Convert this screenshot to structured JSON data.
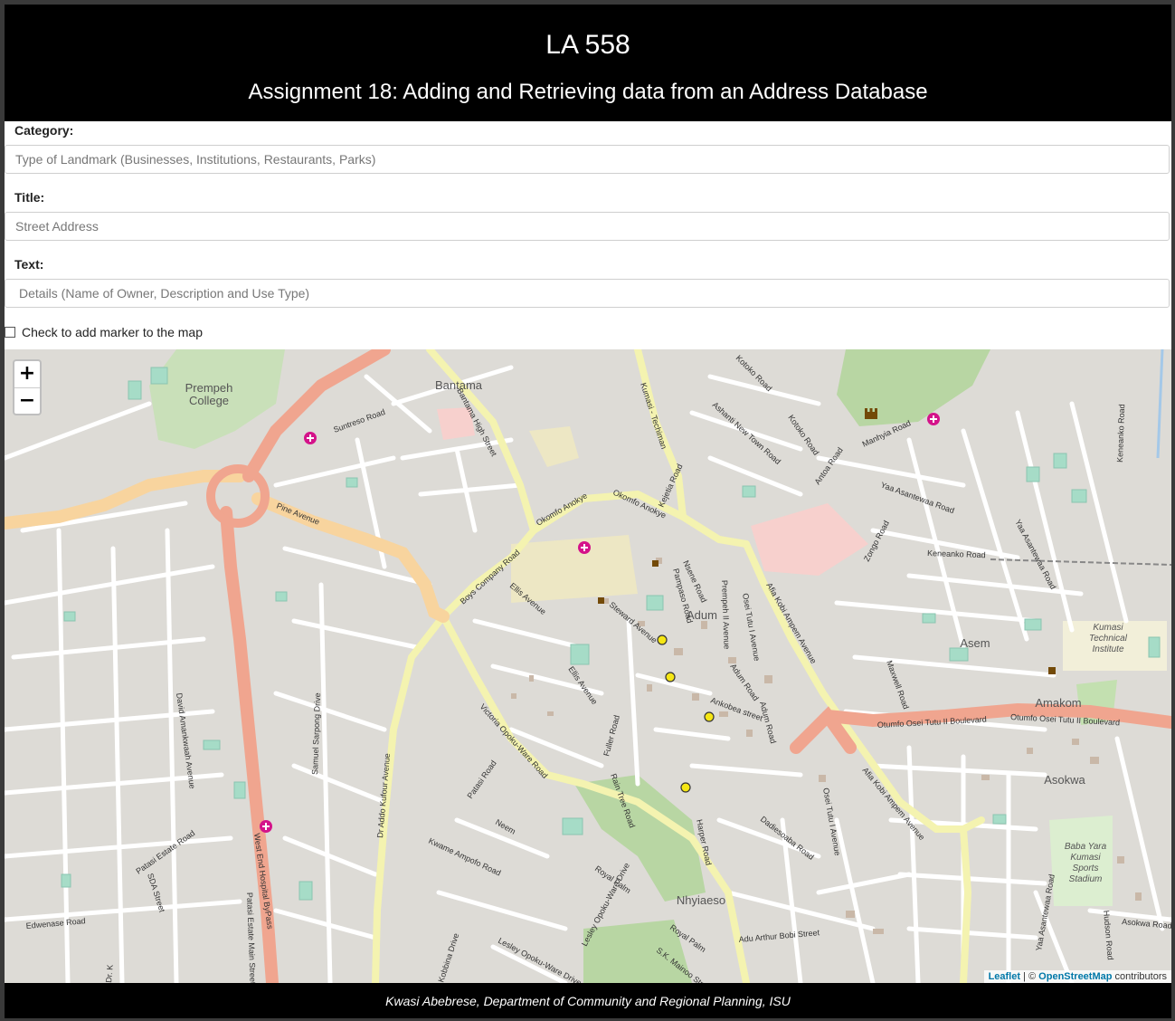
{
  "header": {
    "title": "LA 558",
    "subtitle": "Assignment 18: Adding and Retrieving data from an Address Database"
  },
  "form": {
    "category_label": "Category:",
    "category_placeholder": "Type of Landmark (Businesses, Institutions, Restaurants, Parks)",
    "title_label": "Title:",
    "title_placeholder": "Street Address",
    "text_label": "Text:",
    "text_placeholder": "Details (Name of Owner, Description and Use Type)",
    "checkbox_label": "Check to add marker to the map",
    "checkbox_checked": false
  },
  "map": {
    "zoom_in": "+",
    "zoom_out": "−",
    "attribution": {
      "leaflet": "Leaflet",
      "separator": " | © ",
      "osm": "OpenStreetMap",
      "suffix": " contributors"
    },
    "place_labels": {
      "prempeh": "Prempeh",
      "college": "College",
      "bantama": "Bantama",
      "adum": "Adum",
      "asem": "Asem",
      "amakom": "Amakom",
      "asokwa": "Asokwa",
      "nhyiaeso": "Nhyiaeso",
      "kumasi_tech_1": "Kumasi",
      "kumasi_tech_2": "Technical",
      "kumasi_tech_3": "Institute",
      "stadium_1": "Baba Yara",
      "stadium_2": "Kumasi",
      "stadium_3": "Sports",
      "stadium_4": "Stadium"
    },
    "road_labels": {
      "suntreso": "Suntreso Road",
      "pine": "Pine Avenue",
      "bantama_high": "Bantama High Street",
      "kumasi_techiman": "Kumasi - Techiman",
      "okomfo_anokye_1": "Okomfo Anokye",
      "okomfo_anokye_2": "Okomfo Anokye",
      "kejetia": "Kejetia Road",
      "boys_company": "Boys Company Road",
      "ellis_1": "Ellis Avenue",
      "ellis_2": "Ellis Avenue",
      "steward": "Steward Avenue",
      "prempeh_ii": "Prempeh II Avenue",
      "osei_tutu_1": "Osei Tutu I Avenue",
      "osei_tutu_2": "Osei Tutu I Avenue",
      "afia_kobi_1": "Afia Kobi Ampem Avenue",
      "afia_kobi_2": "Afia Kobi Ampem Avenue",
      "otumfo_1": "Otumfo Osei Tutu II Boulevard",
      "otumfo_2": "Otumfo Osei Tutu II Boulevard",
      "manhyia": "Manhyia Road",
      "yaa_asantewaa_1": "Yaa Asantewaa Road",
      "yaa_asantewaa_2": "Yaa Asantewaa Road",
      "yaa_asantewaa_3": "Yaa Asantewaa Road",
      "keneanko_1": "Keneanko Road",
      "keneanko_2": "Keneanko Road",
      "zongo": "Zongo Road",
      "antoa": "Antoa Road",
      "kotoko": "Kotoko Road",
      "kotoko_2": "Kotoko Road",
      "ashanti_new_town": "Ashanti New Town Road",
      "maxwell": "Maxwell Road",
      "adum_rd": "Adum Road",
      "ankobea": "Ankobea street",
      "harper": "Harper Road",
      "fuller": "Fuller Road",
      "rain_tree": "Rain Tree Road",
      "victoria": "Victoria Opoku-Ware Road",
      "dr_addo": "Dr Addo Kufour Avenue",
      "samuel": "Samuel Sarpong Drive",
      "west_end": "West End Hospital ByPass",
      "david": "David Amankwaah Avenue",
      "patasi_estate": "Patasi Estate Road",
      "patasi_main": "Patasi Estate Main Street",
      "sda": "SDA Street",
      "edwenase": "Edwenase Road",
      "kwame_ampofo": "Kwame Ampofo Road",
      "neem": "Neem",
      "patasi_road": "Patasi Road",
      "royal_palm_1": "Royal Palm",
      "royal_palm_2": "Royal Palm",
      "lesley_1": "Lesley Opoku-Ware Drive",
      "lesley_2": "Lesley Opoku-Ware Drive",
      "kobbina": "Kobbina Drive",
      "sk_mainoo": "S.K. Mainoo Street",
      "adu_arthur": "Adu Arthur Bobi Street",
      "dadiesoaba": "Dadiesoaba Road",
      "asokwa_road": "Asokwa Road",
      "hudson": "Hudson Road",
      "nsene": "Nsene Road",
      "pampaso": "Pampaso Road",
      "dr_k": "Dr. K"
    },
    "markers": [
      {
        "type": "hospital",
        "name": "hospital-marker-suntreso"
      },
      {
        "type": "hospital",
        "name": "hospital-marker-komfo-anokye"
      },
      {
        "type": "hospital",
        "name": "hospital-marker-manhyia"
      },
      {
        "type": "hospital",
        "name": "hospital-marker-west-end"
      },
      {
        "type": "circle",
        "color": "#f5e614",
        "name": "address-marker-1"
      },
      {
        "type": "circle",
        "color": "#f5e614",
        "name": "address-marker-2"
      },
      {
        "type": "circle",
        "color": "#f5e614",
        "name": "address-marker-3"
      },
      {
        "type": "circle",
        "color": "#f5e614",
        "name": "address-marker-4"
      }
    ]
  },
  "footer": {
    "credit": "Kwasi Abebrese, Department of Community and Regional Planning, ISU"
  },
  "colors": {
    "header_bg": "#000000",
    "map_bg": "#dddbd6",
    "primary_road": "#f0a58f",
    "secondary_road": "#f8d49e",
    "tertiary_road": "#f4f3b0",
    "park": "#b8d6a3",
    "hospital_area": "#f7d0cd",
    "marker_yellow": "#f5e614",
    "hospital_icon": "#d4138a"
  }
}
